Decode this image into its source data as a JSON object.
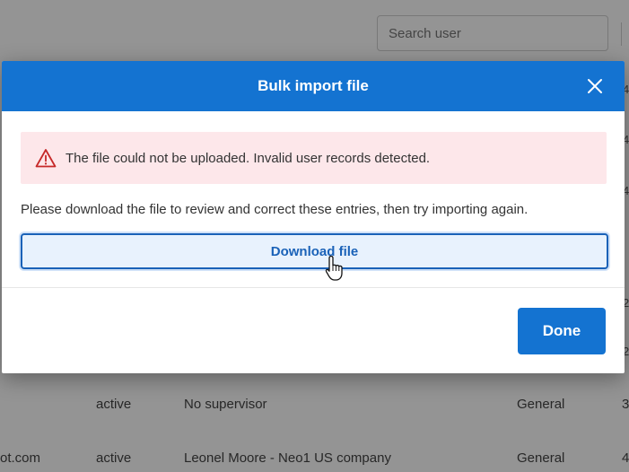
{
  "background": {
    "search": {
      "placeholder": "Search user"
    },
    "rows": [
      {
        "email": "",
        "status": "active",
        "supervisor": "No supervisor",
        "group": "General",
        "edge": "3"
      },
      {
        "email": "ot.com",
        "status": "active",
        "supervisor": "Leonel Moore - Neo1 US company",
        "group": "General",
        "edge": "4"
      }
    ],
    "edge_chars": [
      "4",
      "4",
      "4",
      "2",
      "2"
    ]
  },
  "modal": {
    "title": "Bulk import file",
    "close_icon": "close-icon",
    "alert": {
      "icon": "warning-triangle-icon",
      "color": "#c62828",
      "background": "#fde7ea",
      "text": "The file could not be uploaded. Invalid user records detected."
    },
    "instructions": "Please download the file to review and correct these entries, then try importing again.",
    "download_button": "Download file",
    "done_button": "Done"
  },
  "colors": {
    "accent": "#1473d1",
    "link": "#1a62b8"
  }
}
